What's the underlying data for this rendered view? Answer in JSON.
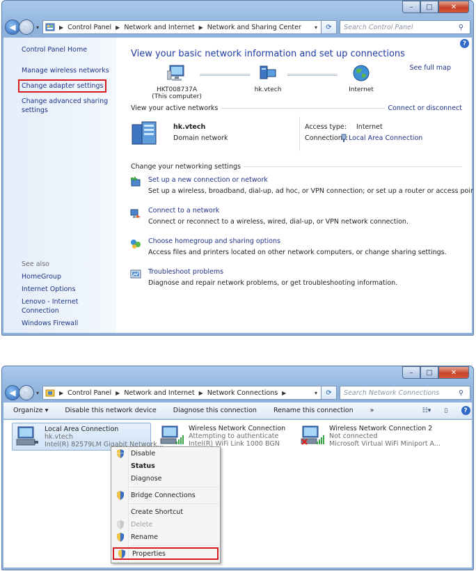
{
  "top_window": {
    "caption": {
      "min": "–",
      "max": "□",
      "close": "✕"
    },
    "address": {
      "crumbs": [
        "Control Panel",
        "Network and Internet",
        "Network and Sharing Center"
      ]
    },
    "search_placeholder": "Search Control Panel",
    "sidebar": {
      "home": "Control Panel Home",
      "items": [
        "Manage wireless networks",
        "Change adapter settings",
        "Change advanced sharing settings"
      ],
      "see_also_label": "See also",
      "see_also": [
        "HomeGroup",
        "Internet Options",
        "Lenovo - Internet Connection",
        "Windows Firewall"
      ]
    },
    "main": {
      "heading": "View your basic network information and set up connections",
      "see_full_map": "See full map",
      "map": {
        "computer": "HKT008737A",
        "computer_sub": "(This computer)",
        "network": "hk.vtech",
        "internet": "Internet"
      },
      "active_networks_label": "View your active networks",
      "connect_disconnect": "Connect or disconnect",
      "active_network": {
        "name": "hk.vtech",
        "type": "Domain network",
        "access_type_label": "Access type:",
        "access_type_value": "Internet",
        "connections_label": "Connections:",
        "connections_value": "Local Area Connection"
      },
      "change_settings_label": "Change your networking settings",
      "tasks": [
        {
          "link": "Set up a new connection or network",
          "desc": "Set up a wireless, broadband, dial-up, ad hoc, or VPN connection; or set up a router or access point."
        },
        {
          "link": "Connect to a network",
          "desc": "Connect or reconnect to a wireless, wired, dial-up, or VPN network connection."
        },
        {
          "link": "Choose homegroup and sharing options",
          "desc": "Access files and printers located on other network computers, or change sharing settings."
        },
        {
          "link": "Troubleshoot problems",
          "desc": "Diagnose and repair network problems, or get troubleshooting information."
        }
      ]
    }
  },
  "bottom_window": {
    "caption": {
      "min": "–",
      "max": "□",
      "close": "✕"
    },
    "address": {
      "crumbs": [
        "Control Panel",
        "Network and Internet",
        "Network Connections"
      ]
    },
    "search_placeholder": "Search Network Connections",
    "toolbar": {
      "organize": "Organize ▾",
      "disable": "Disable this network device",
      "diagnose": "Diagnose this connection",
      "rename": "Rename this connection",
      "more": "»"
    },
    "connections": [
      {
        "name": "Local Area Connection",
        "status": "hk.vtech",
        "adapter": "Intel(R) 82579LM Gigabit Network..."
      },
      {
        "name": "Wireless Network Connection",
        "status": "Attempting to authenticate",
        "adapter": "Intel(R) WiFi Link 1000 BGN"
      },
      {
        "name": "Wireless Network Connection 2",
        "status": "Not connected",
        "adapter": "Microsoft Virtual WiFi Miniport A..."
      }
    ],
    "context_menu": {
      "disable": "Disable",
      "status": "Status",
      "diagnose": "Diagnose",
      "bridge": "Bridge Connections",
      "shortcut": "Create Shortcut",
      "delete": "Delete",
      "rename": "Rename",
      "properties": "Properties"
    }
  },
  "colors": {
    "link": "#1e3287",
    "heading": "#1e3aa5",
    "highlight_box": "#d71920"
  }
}
